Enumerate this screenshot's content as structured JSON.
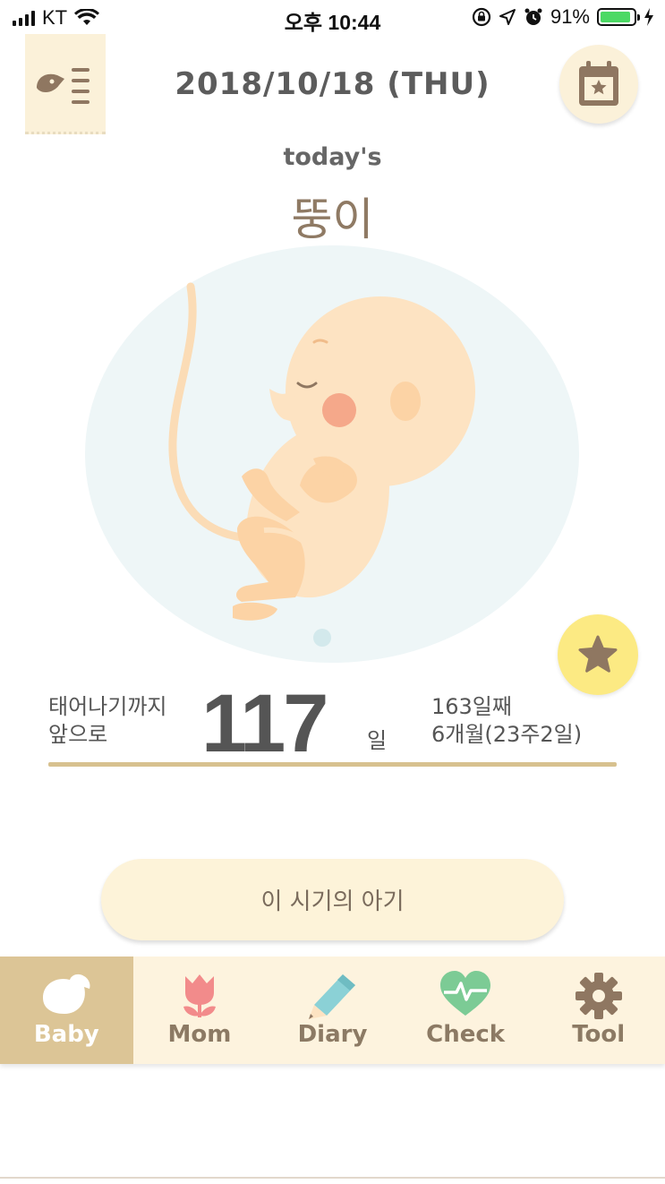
{
  "status_bar": {
    "carrier": "KT",
    "time": "오후 10:44",
    "battery": "91%",
    "battery_level": 0.91,
    "icons": [
      "signal-icon",
      "wifi-icon",
      "rotation-lock-icon",
      "location-icon",
      "alarm-icon",
      "battery-icon",
      "charging-icon"
    ]
  },
  "header": {
    "date": "2018/10/18 (THU)",
    "menu_icon": "menu-tag-icon",
    "calendar_icon": "calendar-star-icon"
  },
  "main": {
    "todays_label": "today's",
    "baby_name": "뚱이",
    "until_birth_line1": "태어나기까지",
    "until_birth_line2": "앞으로",
    "days_remaining": "117",
    "days_unit": "일",
    "day_number": "163일째",
    "age_detail": "6개월(23주2일)",
    "favorite_icon": "star-icon",
    "period_button_label": "이 시기의 아기"
  },
  "tab_bar": {
    "tabs": [
      {
        "label": "Baby",
        "icon": "bird-icon",
        "active": true
      },
      {
        "label": "Mom",
        "icon": "tulip-icon",
        "active": false
      },
      {
        "label": "Diary",
        "icon": "pencil-icon",
        "active": false
      },
      {
        "label": "Check",
        "icon": "heart-pulse-icon",
        "active": false
      },
      {
        "label": "Tool",
        "icon": "gear-icon",
        "active": false
      }
    ]
  },
  "colors": {
    "accent_tan": "#dcc596",
    "cream": "#fdf3de",
    "star_yellow": "#fcea83",
    "baby_skin": "#fde3c2",
    "womb_bg": "#eef6f7"
  }
}
